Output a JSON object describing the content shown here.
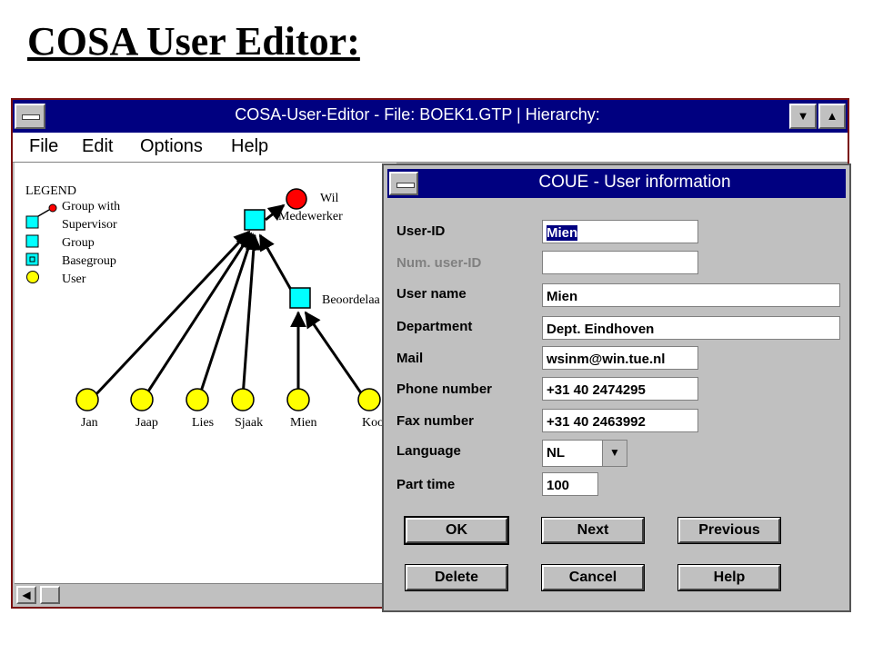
{
  "slide": {
    "title": "COSA User Editor:"
  },
  "main_window": {
    "title": "COSA-User-Editor - File: BOEK1.GTP | Hierarchy:",
    "menu": [
      "File",
      "Edit",
      "Options",
      "Help"
    ],
    "scroll_left": "◀"
  },
  "legend": {
    "title": "LEGEND",
    "items": [
      "Group with",
      "Supervisor",
      "Group",
      "Basegroup",
      "User"
    ]
  },
  "hierarchy": {
    "supervisor_name": "Wil",
    "top_group": "Medewerker",
    "sub_group": "Beoordelaa",
    "users": [
      "Jan",
      "Jaap",
      "Lies",
      "Sjaak",
      "Mien",
      "Koo"
    ]
  },
  "colors": {
    "titlebar": "#000080",
    "group": "#00ffff",
    "user": "#ffff00",
    "supervisor": "#ff0000"
  },
  "dialog": {
    "title": "COUE - User information",
    "labels": {
      "user_id": "User-ID",
      "num_user_id": "Num. user-ID",
      "user_name": "User name",
      "department": "Department",
      "mail": "Mail",
      "phone": "Phone number",
      "fax": "Fax number",
      "language": "Language",
      "part_time": "Part time"
    },
    "values": {
      "user_id": "Mien",
      "num_user_id": "",
      "user_name": "Mien",
      "department": "Dept. Eindhoven",
      "mail": "wsinm@win.tue.nl",
      "phone": "+31 40 2474295",
      "fax": "+31 40 2463992",
      "language": "NL",
      "part_time": "100"
    },
    "buttons": {
      "ok": "OK",
      "next": "Next",
      "previous": "Previous",
      "delete": "Delete",
      "cancel": "Cancel",
      "help": "Help"
    }
  }
}
